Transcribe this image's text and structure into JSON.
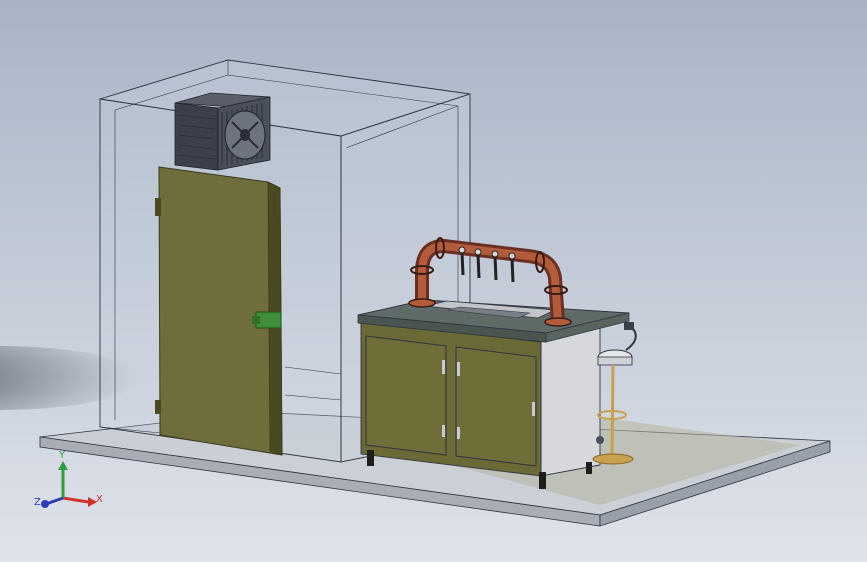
{
  "viewport": {
    "background_top": "#a8b4c6",
    "background_bottom": "#dfe3ea",
    "shadow_color": "#2a2f36"
  },
  "colors": {
    "room_wireframe": "#2e3440",
    "room_glass": "#c9d2de",
    "floor_slab": "#c7cbd1",
    "floor_texture": "#b7b59f",
    "door_panel": "#6f6d3a",
    "door_edge": "#4a4a22",
    "door_handle": "#3f8f3a",
    "condenser_body": "#3b3f4a",
    "condenser_fan": "#2a2d34",
    "counter_top": "#5f6b66",
    "cabinet_front": "#6b6a36",
    "cabinet_side": "#d6d8dc",
    "pipe_copper": "#b35c3c",
    "pipe_dark": "#6a2f22",
    "drip_tray": "#c2c5ca",
    "stool_seat": "#e4e6ea",
    "stool_base": "#c8a050",
    "cabinet_feet": "#1e1e1e"
  },
  "axis_triad": {
    "x_label": "X",
    "y_label": "Y",
    "z_label": "Z",
    "x_color": "#d0342c",
    "y_color": "#2f9e3f",
    "z_color": "#2a3fb5"
  }
}
